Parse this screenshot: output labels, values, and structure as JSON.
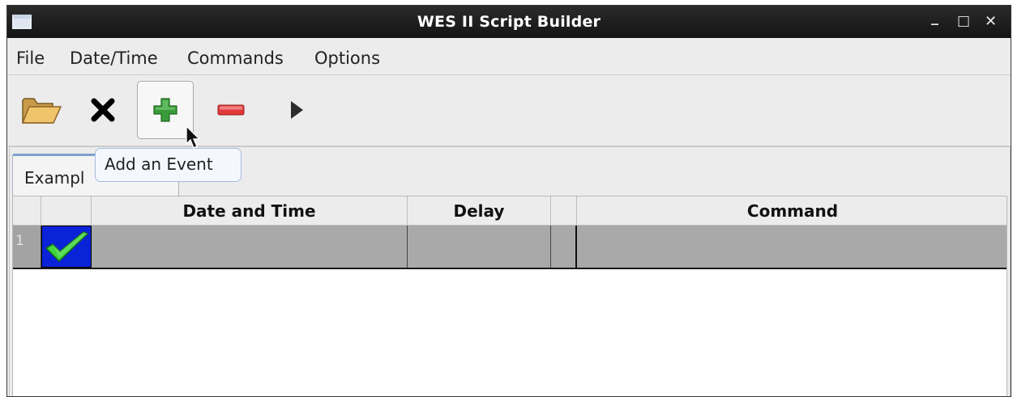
{
  "window": {
    "title": "WES II Script Builder",
    "controls": {
      "minimize": "_",
      "maximize": "□",
      "close": "✕"
    }
  },
  "menubar": {
    "items": [
      {
        "label": "File"
      },
      {
        "label": "Date/Time"
      },
      {
        "label": "Commands"
      },
      {
        "label": "Options"
      }
    ]
  },
  "toolbar": {
    "icons": [
      "open-folder-icon",
      "delete-icon",
      "add-event-icon",
      "remove-event-icon",
      "run-icon"
    ],
    "hovered": "add-event-icon"
  },
  "tooltip": {
    "text": "Add an Event"
  },
  "tabs": [
    {
      "label": "Exampl"
    }
  ],
  "grid": {
    "columns": [
      "",
      "",
      "Date and Time",
      "Delay",
      "",
      "Command"
    ],
    "rows": [
      {
        "number": "1",
        "status_icon": "green-check-icon",
        "date_time": "",
        "delay": "",
        "flag": "",
        "command": ""
      }
    ],
    "selected_row": 0
  },
  "colors": {
    "titlebar": "#1a1a1a",
    "selected_row": "#a9a9a9",
    "status_cell": "#0a23d9",
    "check": "#3fd33c",
    "add_icon": "#3a9a3a",
    "remove_icon": "#e23a3a"
  }
}
